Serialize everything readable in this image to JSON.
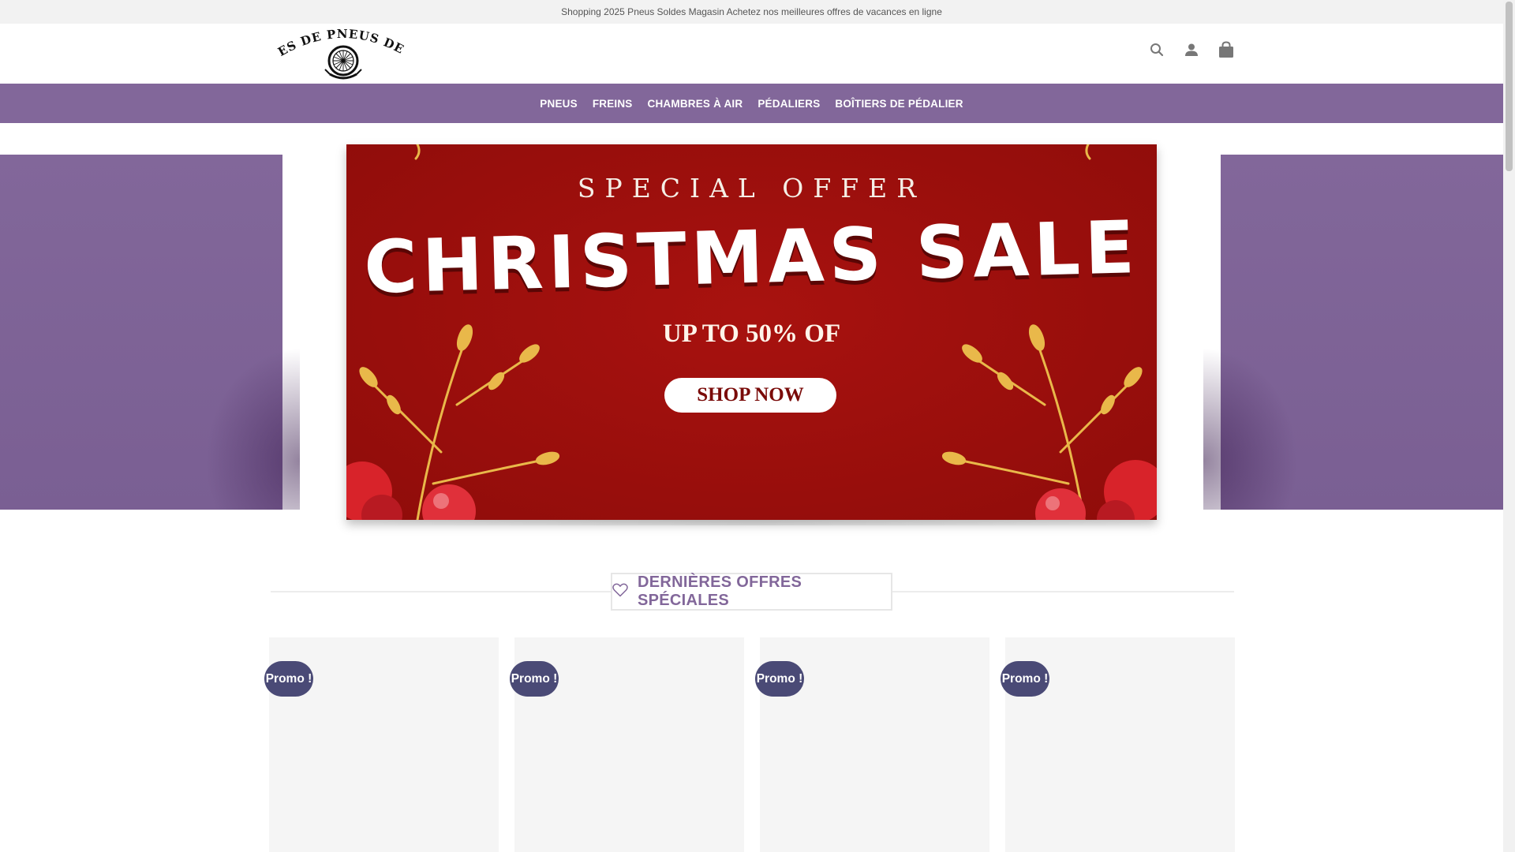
{
  "topbar": {
    "text": "Shopping 2025 Pneus Soldes Magasin Achetez nos meilleures offres de vacances en ligne"
  },
  "header": {
    "logo_text": "OFFRES DE PNEUS DE VÉLO",
    "icons": [
      "search-icon",
      "account-icon",
      "cart-icon"
    ]
  },
  "nav": {
    "items": [
      {
        "label": "PNEUS"
      },
      {
        "label": "FREINS"
      },
      {
        "label": "CHAMBRES À AIR"
      },
      {
        "label": "PÉDALIERS"
      },
      {
        "label": "BOÎTIERS DE PÉDALIER"
      }
    ]
  },
  "banner": {
    "subtitle": "SPECIAL OFFER",
    "title": "CHRISTMAS SALE",
    "offer": "UP TO 50% OF",
    "cta": "SHOP NOW"
  },
  "section": {
    "title": "DERNIÈRES OFFRES SPÉCIALES",
    "icon": "heart-icon"
  },
  "products": [
    {
      "badge": "Promo !"
    },
    {
      "badge": "Promo !"
    },
    {
      "badge": "Promo !"
    },
    {
      "badge": "Promo !"
    }
  ],
  "colors": {
    "accent": "#82679a",
    "badge": "#4a4a76",
    "banner_red": "#a8120f",
    "topbar": "#f2f2f2"
  }
}
